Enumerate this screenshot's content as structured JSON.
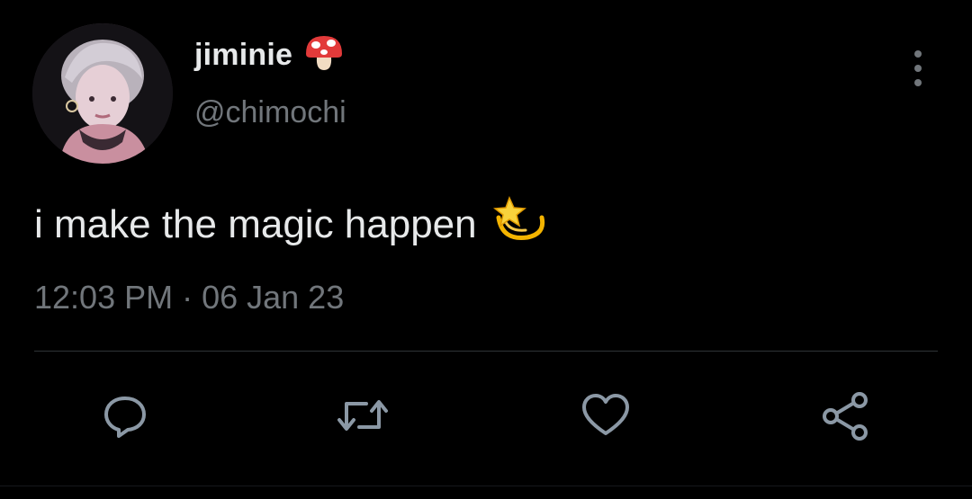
{
  "user": {
    "display_name": "jiminie",
    "handle": "@chimochi",
    "name_emoji": "mushroom-icon"
  },
  "tweet": {
    "text": "i make the magic happen",
    "text_emoji": "dizzy-star-icon",
    "timestamp": "12:03 PM · 06 Jan 23"
  },
  "actions": [
    "reply-icon",
    "retweet-icon",
    "like-icon",
    "share-icon"
  ],
  "colors": {
    "background": "#000000",
    "primary_text": "#e7e9ea",
    "secondary_text": "#71767b",
    "divider": "#2f3336"
  }
}
